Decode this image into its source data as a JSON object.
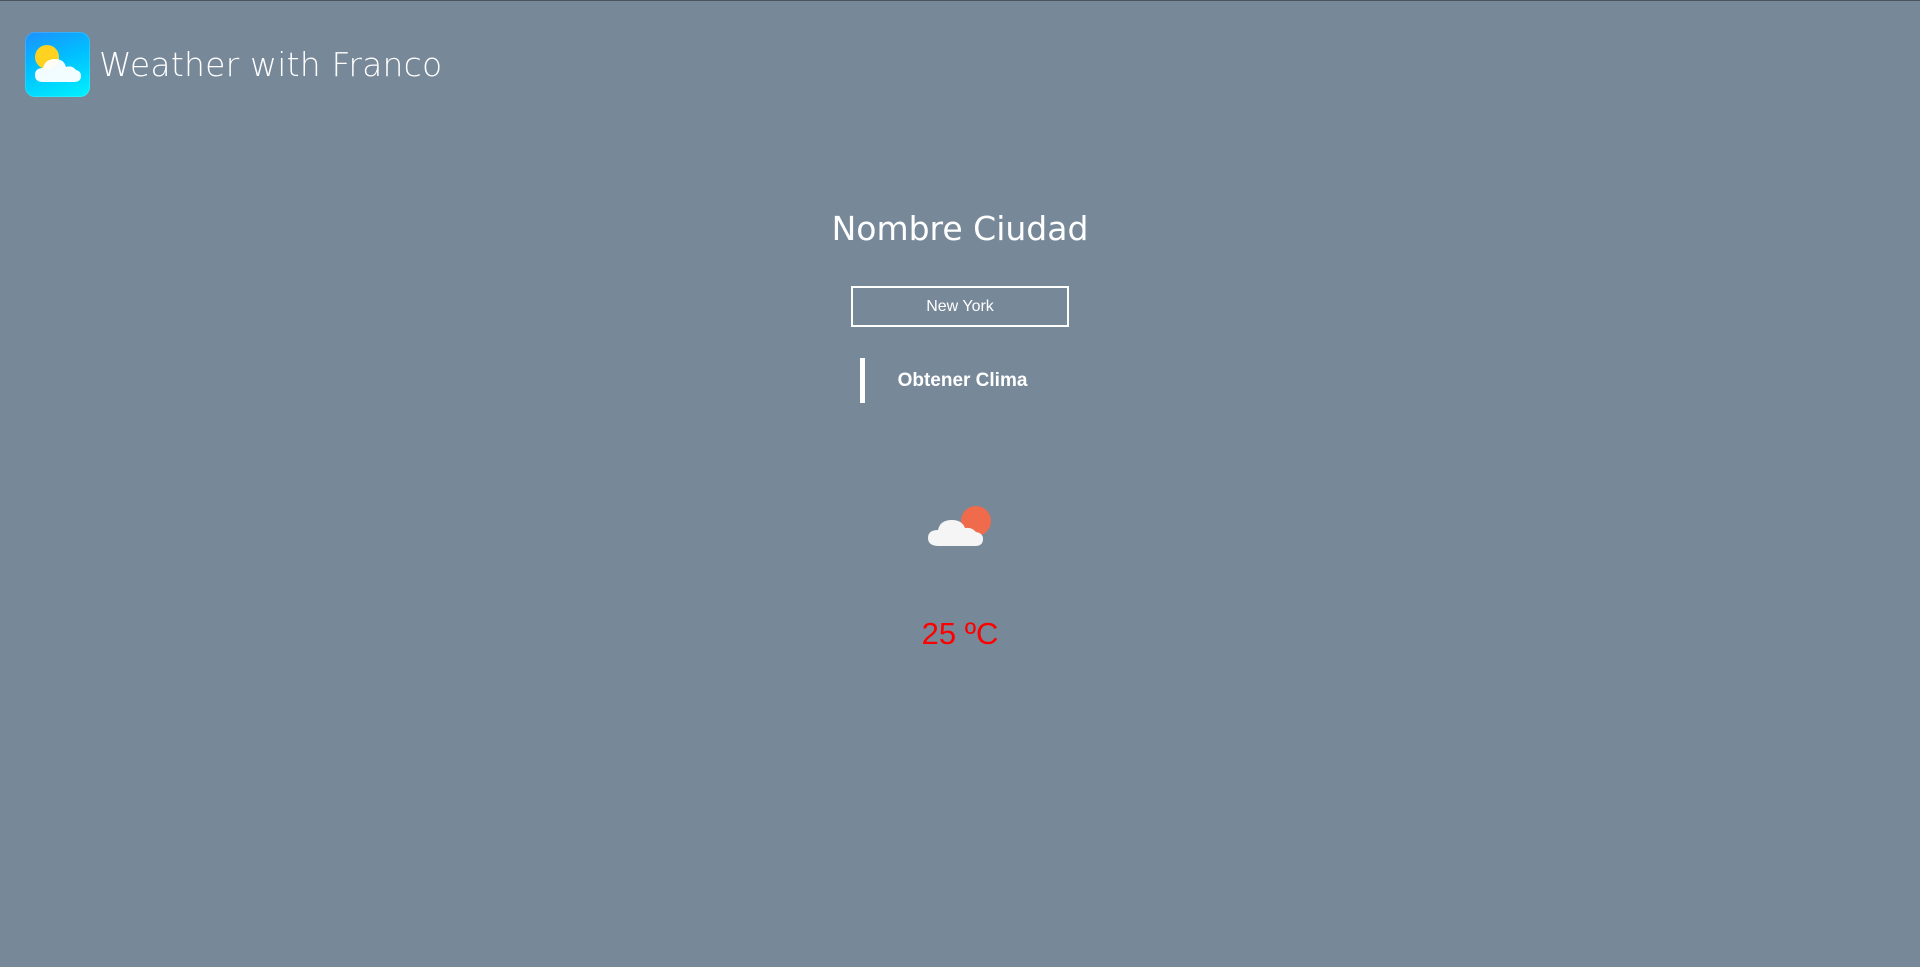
{
  "header": {
    "logo_icon": "partly-cloudy-app-icon",
    "title": "Weather with Franco"
  },
  "form": {
    "heading": "Nombre Ciudad",
    "city_value": "New York",
    "submit_label": "Obtener Clima"
  },
  "result": {
    "icon": "partly-cloudy-icon",
    "temperature": "25 ºC"
  },
  "colors": {
    "background": "#778899",
    "temperature": "#ff0000",
    "sun": "#ef6b4c"
  }
}
